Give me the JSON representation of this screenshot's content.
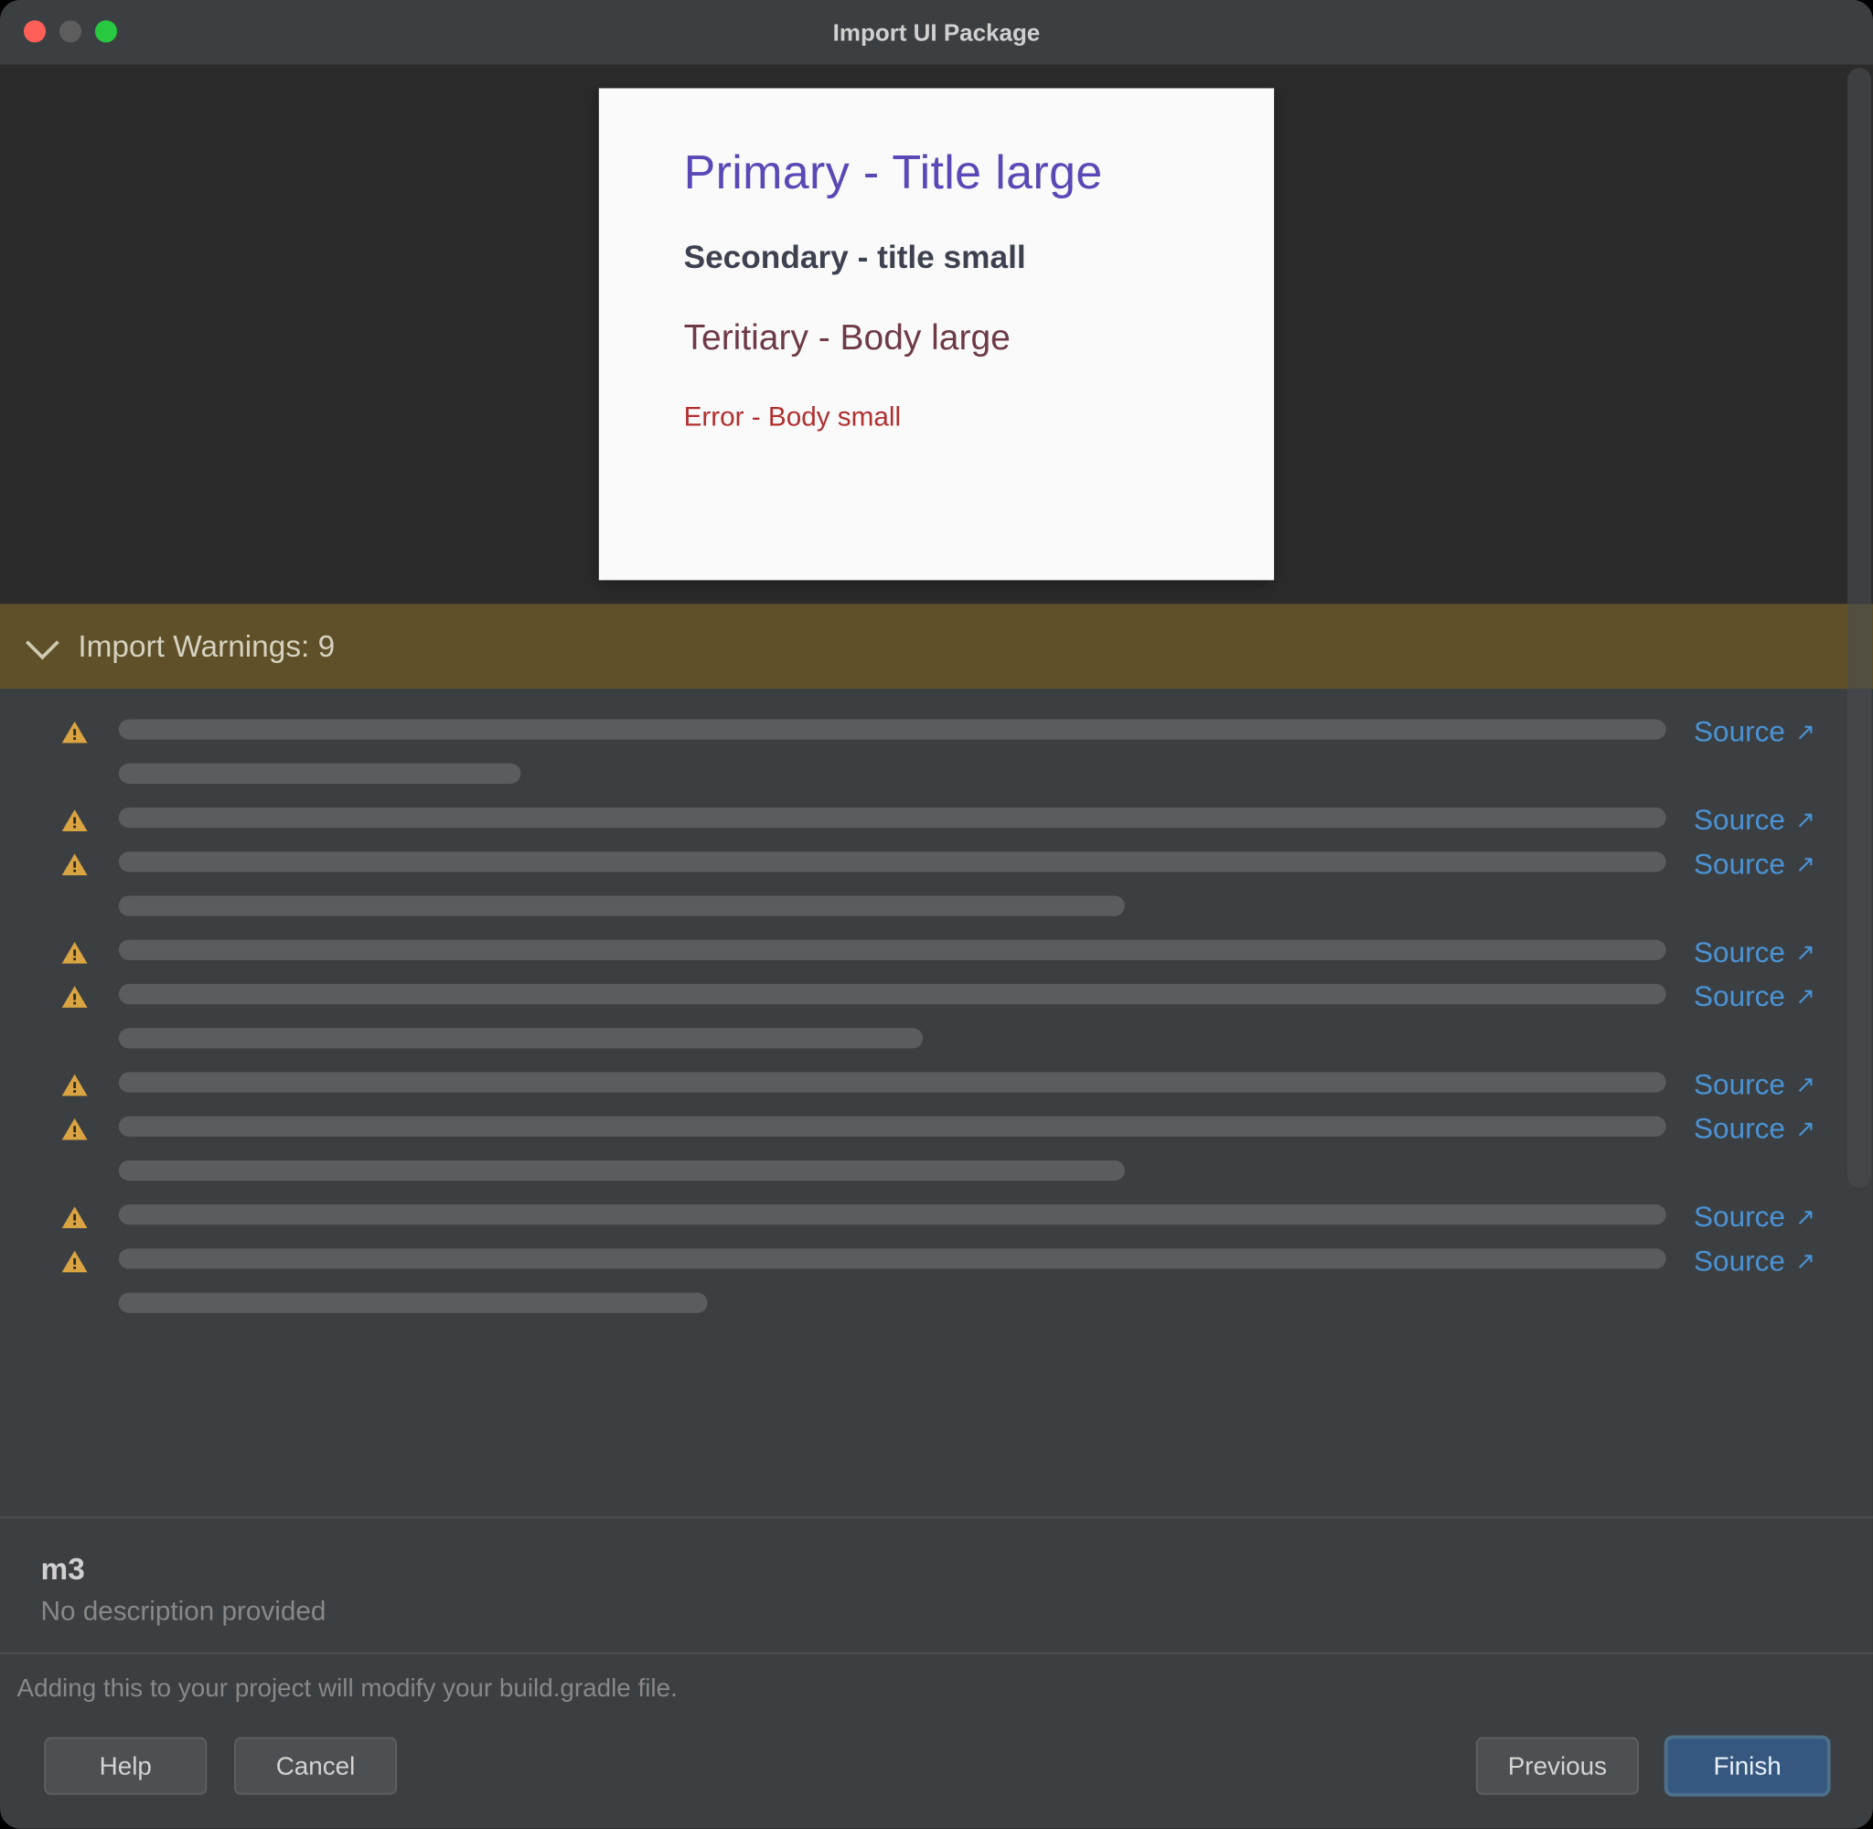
{
  "window": {
    "title": "Import UI Package"
  },
  "preview": {
    "primary": "Primary - Title large",
    "secondary": "Secondary - title small",
    "tertiary": "Teritiary - Body large",
    "error": "Error - Body small"
  },
  "warnings": {
    "header_label": "Import Warnings:",
    "count": "9",
    "source_link_label": "Source",
    "items": [
      {
        "bar_widths": [
          "full",
          "w26"
        ]
      },
      {
        "bar_widths": [
          "full"
        ]
      },
      {
        "bar_widths": [
          "full",
          "w65"
        ]
      },
      {
        "bar_widths": [
          "full"
        ]
      },
      {
        "bar_widths": [
          "full",
          "w52"
        ]
      },
      {
        "bar_widths": [
          "full"
        ]
      },
      {
        "bar_widths": [
          "full",
          "w65"
        ]
      },
      {
        "bar_widths": [
          "full"
        ]
      },
      {
        "bar_widths": [
          "full",
          "w38"
        ]
      }
    ]
  },
  "meta": {
    "name": "m3",
    "description": "No description provided"
  },
  "footer": {
    "note": "Adding this to your project will modify your build.gradle file.",
    "help": "Help",
    "cancel": "Cancel",
    "previous": "Previous",
    "finish": "Finish"
  },
  "icons": {
    "warning": "warning-triangle",
    "chevron": "chevron-down",
    "external": "arrow-up-right"
  }
}
